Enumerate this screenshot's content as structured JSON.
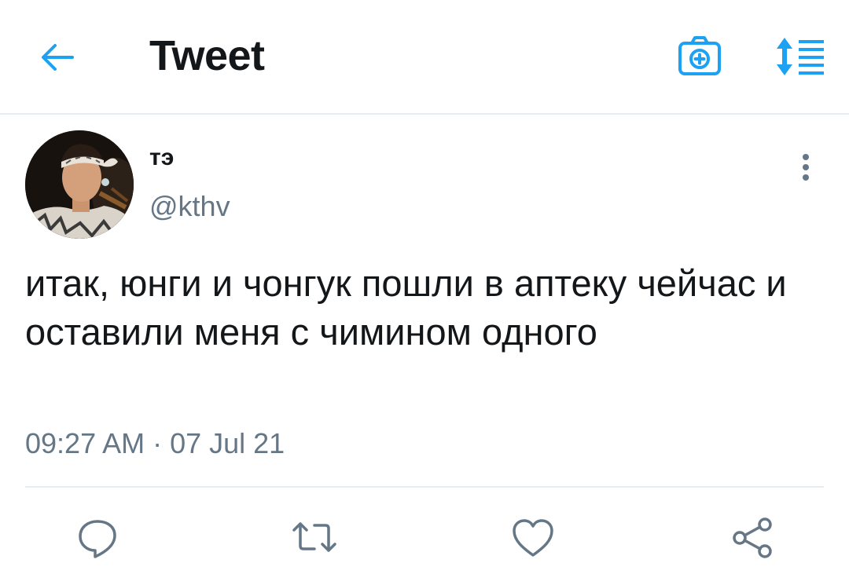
{
  "header": {
    "title": "Tweet",
    "back_icon": "arrow-left-icon",
    "camera_icon": "camera-add-icon",
    "sort_icon": "sort-list-icon",
    "accent_color": "#1da1f2"
  },
  "tweet": {
    "display_name": "тэ",
    "handle": "@kthv",
    "text": "итак, юнги и чонгук пошли в аптеку чейчас и оставили меня с чимином одного",
    "time": "09:27 AM · 07 Jul 21"
  },
  "actions": {
    "reply_icon": "reply-icon",
    "retweet_icon": "retweet-icon",
    "like_icon": "heart-icon",
    "share_icon": "share-icon",
    "icon_color": "#657786"
  }
}
